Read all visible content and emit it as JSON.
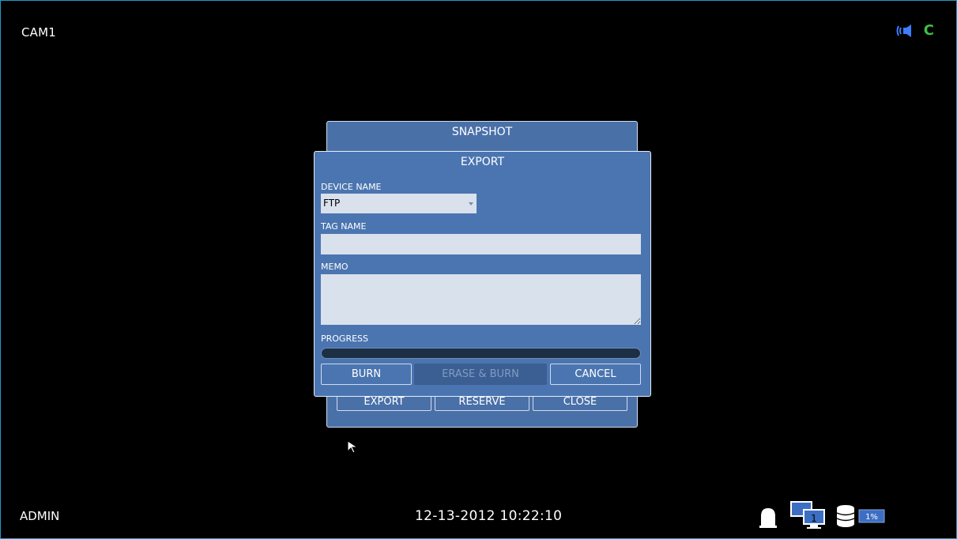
{
  "screen": {
    "camera": "CAM1",
    "user": "ADMIN",
    "datetime": "12-13-2012  10:22:10",
    "top_right_letter": "C",
    "hdd_usage": "1%",
    "monitor_number": "1",
    "colors": {
      "accent_blue": "#4b75b0",
      "c_icon": "#3fbf46",
      "audio_icon": "#3d7dff"
    }
  },
  "snapshot": {
    "title": "SNAPSHOT",
    "buttons": {
      "export": "EXPORT",
      "reserve": "RESERVE",
      "close": "CLOSE"
    }
  },
  "export_dialog": {
    "title": "EXPORT",
    "device_name_label": "DEVICE NAME",
    "device_name_value": "FTP",
    "tag_name_label": "TAG NAME",
    "tag_name_value": "",
    "memo_label": "MEMO",
    "memo_value": "",
    "progress_label": "PROGRESS",
    "progress": 0,
    "buttons": {
      "burn": "BURN",
      "erase_burn": "ERASE & BURN",
      "cancel": "CANCEL"
    }
  }
}
